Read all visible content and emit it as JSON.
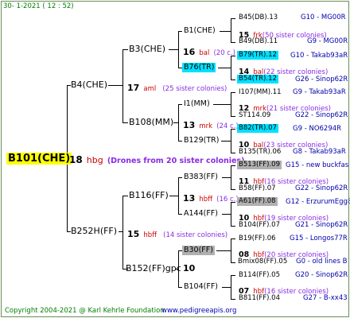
{
  "header": {
    "date": "30-   1-2021  (  12 : 52)"
  },
  "footer": {
    "copyright": "Copyright 2004-2021 @ Karl Kehrle Foundation",
    "url": "www.pedigreeapis.org"
  },
  "colors": {
    "yellow": "#ffff00",
    "cyan": "#00e0ff",
    "gray": "#b0b0b0",
    "red": "#cc0000",
    "purple": "#8a2be2",
    "blue": "#0000aa",
    "green": "#008000"
  },
  "root": {
    "label": "B101(CHE)",
    "year": "18",
    "code": "hbg",
    "note": "(Drones from 20 sister colonies)"
  },
  "g1": [
    {
      "label": "B4(CHE)",
      "year": "17",
      "code": "aml",
      "note": "(25 sister colonies)"
    },
    {
      "label": "B252H(FF)",
      "year": "15",
      "code": "hbff",
      "note": "(14 sister colonies)"
    }
  ],
  "g2": [
    {
      "label": "B3(CHE)",
      "year": "16",
      "code": "bal",
      "note": "(20 c.)"
    },
    {
      "label": "B108(MM)",
      "year": "13",
      "code": "mrk",
      "note": "(24 c.)"
    },
    {
      "label": "B116(FF)",
      "year": "13",
      "code": "hbff",
      "note": "(16 c.)"
    },
    {
      "label": "B152(FF)gpc",
      "year": "10",
      "code": "",
      "note": ""
    }
  ],
  "g3": [
    {
      "label": "B1(CHE)"
    },
    {
      "label": "B76(TR)"
    },
    {
      "label": "I1(MM)"
    },
    {
      "label": "B129(TR)"
    },
    {
      "label": "B383(FF)"
    },
    {
      "label": "A144(FF)"
    },
    {
      "label": "B30(FF)"
    },
    {
      "label": "B104(FF)"
    }
  ],
  "g4": [
    {
      "label": "B45(DB).13",
      "origin": "G10 - MG00R"
    },
    {
      "year": "15",
      "code": "frk",
      "note": "(50 sister colonies)"
    },
    {
      "label": "B49(DB).11",
      "origin": "G9 - MG00R"
    },
    {
      "label": "B79(TR).12",
      "origin": "G10 - Takab93aR"
    },
    {
      "year": "14",
      "code": "bal",
      "note": "(22 sister colonies)"
    },
    {
      "label": "B54(TR).12",
      "origin": "G26 - Sinop62R"
    },
    {
      "label": "I107(MM).11",
      "origin": "G9 - Takab93aR"
    },
    {
      "year": "12",
      "code": "mrk",
      "note": "(21 sister colonies)"
    },
    {
      "label": "ST114.09",
      "origin": "G22 - Sinop62R"
    },
    {
      "label": "B82(TR).07",
      "origin": "G9 - NO6294R"
    },
    {
      "year": "10",
      "code": "bal",
      "note": "(23 sister colonies)"
    },
    {
      "label": "B135(TR).06",
      "origin": "G8 - Takab93aR"
    },
    {
      "label": "B513(FF).09",
      "origin": "G15 - new buckfas"
    },
    {
      "year": "11",
      "code": "hbf",
      "note": "(16 sister colonies)"
    },
    {
      "label": "B58(FF).07",
      "origin": "G22 - Sinop62R"
    },
    {
      "label": "A61(FF).08",
      "origin": "G12 - ErzurumEgg8"
    },
    {
      "year": "10",
      "code": "hbf",
      "note": "(19 sister colonies)"
    },
    {
      "label": "B104(FF).07",
      "origin": "G21 - Sinop62R"
    },
    {
      "label": "B19(FF).06",
      "origin": "G15 - Longos77R"
    },
    {
      "year": "08",
      "code": "hbf",
      "note": "(20 sister colonies)"
    },
    {
      "label": "Bmix08(FF).05",
      "origin": "G0 - old lines B"
    },
    {
      "label": "B114(FF).05",
      "origin": "G20 - Sinop62R"
    },
    {
      "year": "07",
      "code": "hbf",
      "note": "(16 sister colonies)"
    },
    {
      "label": "B811(FF).04",
      "origin": "G27 - B-xx43"
    }
  ]
}
